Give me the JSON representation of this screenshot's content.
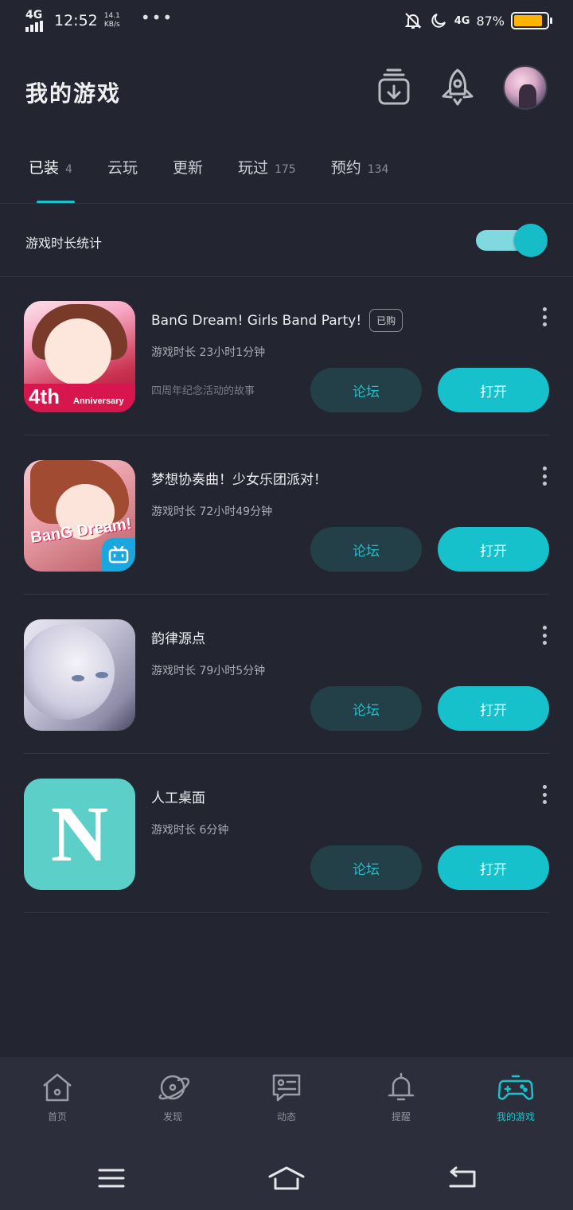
{
  "status_bar": {
    "network": "4G",
    "time": "12:52",
    "speed_value": "14.1",
    "speed_unit": "KB/s",
    "dots": "•••",
    "network_right": "4G",
    "battery_percent": "87%",
    "battery_level": 0.87,
    "battery_color": "#ffb400"
  },
  "header": {
    "title": "我的游戏",
    "icons": [
      "download-icon",
      "rocket-icon"
    ]
  },
  "tabs": [
    {
      "label": "已装",
      "count": "4",
      "active": true
    },
    {
      "label": "云玩",
      "count": "",
      "active": false
    },
    {
      "label": "更新",
      "count": "",
      "active": false
    },
    {
      "label": "玩过",
      "count": "175",
      "active": false
    },
    {
      "label": "预约",
      "count": "134",
      "active": false
    }
  ],
  "stats": {
    "label": "游戏时长统计",
    "toggle_on": true
  },
  "games": [
    {
      "name": "BanG Dream! Girls Band Party!",
      "badge": "已购",
      "playtime": "游戏时长 23小时1分钟",
      "sub": "四周年纪念活动的故事",
      "forum_label": "论坛",
      "open_label": "打开",
      "thumb_text": "4th",
      "thumb_text2": "Anniversary"
    },
    {
      "name": "梦想协奏曲！少女乐团派对！",
      "badge": "",
      "playtime": "游戏时长 72小时49分钟",
      "sub": "",
      "forum_label": "论坛",
      "open_label": "打开",
      "thumb_text": "BanG Dream!"
    },
    {
      "name": "韵律源点",
      "badge": "",
      "playtime": "游戏时长 79小时5分钟",
      "sub": "",
      "forum_label": "论坛",
      "open_label": "打开"
    },
    {
      "name": "人工桌面",
      "badge": "",
      "playtime": "游戏时长 6分钟",
      "sub": "",
      "forum_label": "论坛",
      "open_label": "打开",
      "thumb_text": "N"
    }
  ],
  "bottom_nav": [
    {
      "label": "首页",
      "icon": "home-icon",
      "active": false
    },
    {
      "label": "发现",
      "icon": "planet-icon",
      "active": false
    },
    {
      "label": "动态",
      "icon": "message-icon",
      "active": false
    },
    {
      "label": "提醒",
      "icon": "bell-icon",
      "active": false
    },
    {
      "label": "我的游戏",
      "icon": "gamepad-icon",
      "active": true
    }
  ],
  "colors": {
    "accent": "#19c3cc",
    "background": "#232530",
    "nav_background": "#2c2f3b",
    "forum_button": "#233f48"
  }
}
